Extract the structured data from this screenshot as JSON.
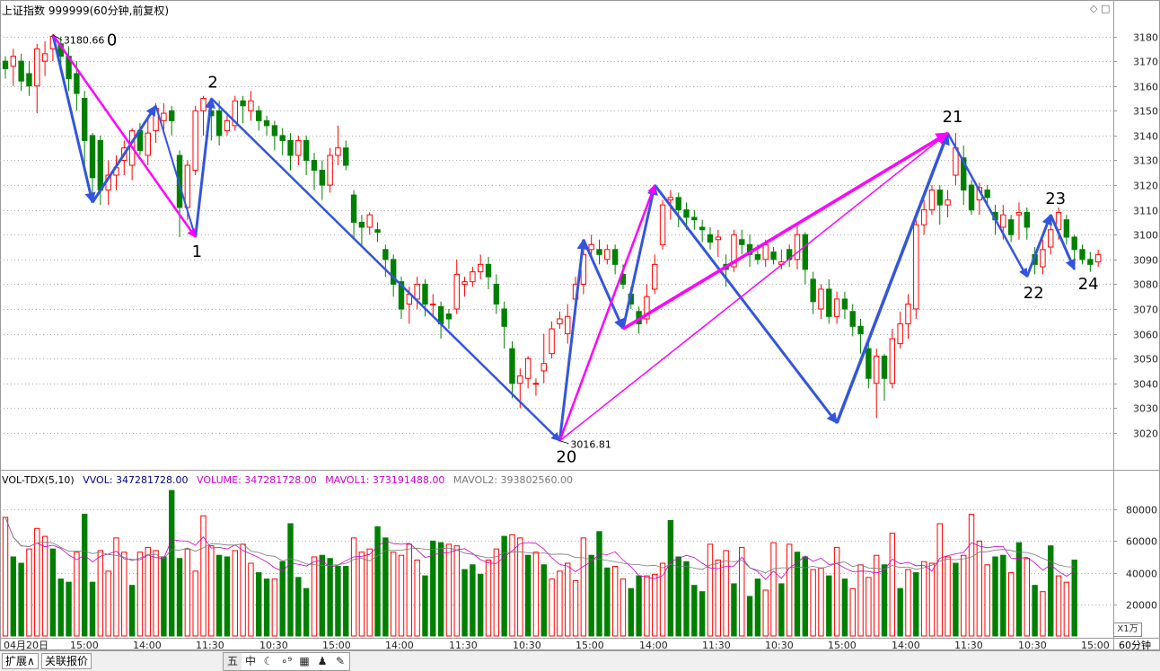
{
  "header": {
    "title": "上证指数 999999(60分钟,前复权)"
  },
  "volume_header": {
    "name": "VOL-TDX(5,10)",
    "vvol": "VVOL: 347281728.00",
    "volume": "VOLUME: 347281728.00",
    "mavol1": "MAVOL1: 373191488.00",
    "mavol2": "MAVOL2: 393802560.00"
  },
  "x_axis": {
    "labels": [
      "04月20日",
      "15:00",
      "14:00",
      "11:30",
      "10:30",
      "15:00",
      "14:00",
      "11:30",
      "10:30",
      "15:00",
      "14:00",
      "11:30",
      "10:30",
      "15:00",
      "14:00",
      "11:30",
      "10:30",
      "15:00"
    ]
  },
  "price_axis": {
    "ticks": [
      "3180",
      "3170",
      "3160",
      "3150",
      "3140",
      "3130",
      "3120",
      "3110",
      "3100",
      "3090",
      "3080",
      "3070",
      "3060",
      "3050",
      "3040",
      "3030",
      "3020"
    ]
  },
  "volume_axis": {
    "ticks": [
      "80000",
      "60000",
      "40000",
      "20000"
    ],
    "unit_label": "X1万"
  },
  "period_label": "60分钟",
  "annotations": {
    "high_price": "3180.66",
    "low_price": "3016.81",
    "wave_labels": [
      "0",
      "1",
      "2",
      "20",
      "21",
      "22",
      "23",
      "24"
    ]
  },
  "bottom_tabs": {
    "expand": "扩展∧",
    "related": "关联报价"
  },
  "toolbar": {
    "icons": [
      "五",
      "中",
      "☾",
      "∘⁹",
      "▦",
      "♟",
      "✎"
    ],
    "icon_names": [
      "five-icon",
      "zhong-icon",
      "moon-icon",
      "dots-icon",
      "keyboard-icon",
      "person-icon",
      "wrench-icon"
    ]
  },
  "top_icons": "◇ □",
  "colors": {
    "up": "#ff0000",
    "down": "#008000",
    "blue_line": "#3355dd",
    "magenta_line": "#ff00ff",
    "mavol1": "#cc00cc",
    "mavol2": "#777777",
    "grid": "#9a9a9a"
  },
  "chart_data": {
    "type": "candlestick",
    "y_range": [
      3012,
      3186
    ],
    "candles": [
      [
        3170,
        3167,
        3172,
        3163
      ],
      [
        3168,
        3172,
        3175,
        3160
      ],
      [
        3170,
        3162,
        3173,
        3158
      ],
      [
        3165,
        3160,
        3170,
        3156
      ],
      [
        3160,
        3175,
        3177,
        3149
      ],
      [
        3170,
        3173,
        3178,
        3164
      ],
      [
        3175,
        3180,
        3181,
        3170
      ],
      [
        3177,
        3172,
        3180,
        3168
      ],
      [
        3172,
        3163,
        3176,
        3158
      ],
      [
        3165,
        3157,
        3170,
        3150
      ],
      [
        3155,
        3138,
        3158,
        3128
      ],
      [
        3140,
        3123,
        3141,
        3115
      ],
      [
        3138,
        3118,
        3140,
        3112
      ],
      [
        3118,
        3124,
        3130,
        3112
      ],
      [
        3124,
        3127,
        3132,
        3118
      ],
      [
        3130,
        3135,
        3138,
        3124
      ],
      [
        3128,
        3142,
        3143,
        3122
      ],
      [
        3142,
        3134,
        3145,
        3132
      ],
      [
        3132,
        3141,
        3148,
        3128
      ],
      [
        3142,
        3151,
        3153,
        3137
      ],
      [
        3146,
        3149,
        3153,
        3142
      ],
      [
        3150,
        3146,
        3152,
        3140
      ],
      [
        3132,
        3111,
        3134,
        3099
      ],
      [
        3111,
        3128,
        3130,
        3106
      ],
      [
        3126,
        3150,
        3152,
        3124
      ],
      [
        3150,
        3155,
        3156,
        3140
      ],
      [
        3150,
        3148,
        3153,
        3138
      ],
      [
        3150,
        3140,
        3154,
        3136
      ],
      [
        3142,
        3146,
        3149,
        3140
      ],
      [
        3144,
        3154,
        3156,
        3142
      ],
      [
        3154,
        3152,
        3156,
        3145
      ],
      [
        3150,
        3154,
        3158,
        3146
      ],
      [
        3150,
        3146,
        3152,
        3142
      ],
      [
        3146,
        3144,
        3148,
        3140
      ],
      [
        3144,
        3140,
        3146,
        3134
      ],
      [
        3140,
        3138,
        3143,
        3132
      ],
      [
        3138,
        3132,
        3141,
        3126
      ],
      [
        3132,
        3138,
        3140,
        3128
      ],
      [
        3138,
        3130,
        3140,
        3124
      ],
      [
        3130,
        3126,
        3133,
        3118
      ],
      [
        3126,
        3120,
        3130,
        3114
      ],
      [
        3120,
        3132,
        3135,
        3117
      ],
      [
        3132,
        3135,
        3144,
        3128
      ],
      [
        3135,
        3128,
        3138,
        3126
      ],
      [
        3116,
        3105,
        3118,
        3098
      ],
      [
        3105,
        3103,
        3108,
        3095
      ],
      [
        3103,
        3108,
        3109,
        3100
      ],
      [
        3102,
        3101,
        3105,
        3097
      ],
      [
        3094,
        3090,
        3096,
        3083
      ],
      [
        3090,
        3080,
        3092,
        3075
      ],
      [
        3081,
        3070,
        3083,
        3066
      ],
      [
        3072,
        3076,
        3079,
        3064
      ],
      [
        3074,
        3080,
        3083,
        3070
      ],
      [
        3080,
        3072,
        3082,
        3067
      ],
      [
        3072,
        3072,
        3076,
        3067
      ],
      [
        3071,
        3064,
        3073,
        3058
      ],
      [
        3068,
        3066,
        3070,
        3062
      ],
      [
        3070,
        3084,
        3090,
        3068
      ],
      [
        3080,
        3081,
        3083,
        3075
      ],
      [
        3081,
        3085,
        3087,
        3079
      ],
      [
        3085,
        3088,
        3092,
        3082
      ],
      [
        3088,
        3083,
        3091,
        3078
      ],
      [
        3080,
        3072,
        3084,
        3068
      ],
      [
        3070,
        3063,
        3073,
        3054
      ],
      [
        3054,
        3040,
        3057,
        3034
      ],
      [
        3040,
        3043,
        3046,
        3030
      ],
      [
        3042,
        3050,
        3051,
        3038
      ],
      [
        3040,
        3040,
        3042,
        3035
      ],
      [
        3045,
        3048,
        3060,
        3040
      ],
      [
        3052,
        3062,
        3065,
        3050
      ],
      [
        3064,
        3066,
        3069,
        3062
      ],
      [
        3060,
        3067,
        3072,
        3056
      ],
      [
        3074,
        3080,
        3083,
        3068
      ],
      [
        3080,
        3092,
        3095,
        3076
      ],
      [
        3094,
        3096,
        3100,
        3090
      ],
      [
        3094,
        3092,
        3098,
        3088
      ],
      [
        3090,
        3094,
        3096,
        3088
      ],
      [
        3094,
        3088,
        3096,
        3084
      ],
      [
        3084,
        3080,
        3088,
        3078
      ],
      [
        3076,
        3072,
        3079,
        3070
      ],
      [
        3069,
        3064,
        3071,
        3060
      ],
      [
        3066,
        3075,
        3080,
        3064
      ],
      [
        3078,
        3088,
        3092,
        3076
      ],
      [
        3096,
        3112,
        3114,
        3094
      ],
      [
        3114,
        3115,
        3118,
        3106
      ],
      [
        3115,
        3110,
        3117,
        3103
      ],
      [
        3110,
        3107,
        3113,
        3102
      ],
      [
        3107,
        3106,
        3110,
        3102
      ],
      [
        3103,
        3102,
        3106,
        3097
      ],
      [
        3100,
        3097,
        3103,
        3094
      ],
      [
        3098,
        3099,
        3102,
        3091
      ],
      [
        3088,
        3086,
        3092,
        3079
      ],
      [
        3087,
        3100,
        3102,
        3085
      ],
      [
        3098,
        3096,
        3102,
        3092
      ],
      [
        3096,
        3092,
        3100,
        3087
      ],
      [
        3092,
        3090,
        3096,
        3088
      ],
      [
        3090,
        3096,
        3098,
        3087
      ],
      [
        3093,
        3090,
        3095,
        3088
      ],
      [
        3088,
        3089,
        3094,
        3086
      ],
      [
        3094,
        3090,
        3096,
        3087
      ],
      [
        3090,
        3100,
        3104,
        3086
      ],
      [
        3100,
        3086,
        3101,
        3080
      ],
      [
        3082,
        3073,
        3085,
        3068
      ],
      [
        3070,
        3078,
        3080,
        3066
      ],
      [
        3078,
        3067,
        3082,
        3064
      ],
      [
        3067,
        3074,
        3077,
        3064
      ],
      [
        3074,
        3070,
        3077,
        3066
      ],
      [
        3069,
        3063,
        3072,
        3059
      ],
      [
        3063,
        3060,
        3066,
        3052
      ],
      [
        3054,
        3042,
        3057,
        3038
      ],
      [
        3040,
        3051,
        3054,
        3026
      ],
      [
        3051,
        3042,
        3052,
        3033
      ],
      [
        3040,
        3058,
        3062,
        3038
      ],
      [
        3056,
        3064,
        3069,
        3054
      ],
      [
        3064,
        3072,
        3076,
        3058
      ],
      [
        3070,
        3104,
        3106,
        3066
      ],
      [
        3104,
        3110,
        3114,
        3100
      ],
      [
        3110,
        3118,
        3120,
        3108
      ],
      [
        3118,
        3112,
        3120,
        3104
      ],
      [
        3112,
        3114,
        3118,
        3107
      ],
      [
        3124,
        3135,
        3141,
        3120
      ],
      [
        3131,
        3118,
        3136,
        3112
      ],
      [
        3120,
        3110,
        3122,
        3108
      ],
      [
        3114,
        3119,
        3121,
        3108
      ],
      [
        3118,
        3115,
        3120,
        3112
      ],
      [
        3109,
        3106,
        3112,
        3100
      ],
      [
        3103,
        3108,
        3112,
        3098
      ],
      [
        3106,
        3100,
        3108,
        3097
      ],
      [
        3108,
        3109,
        3113,
        3098
      ],
      [
        3109,
        3103,
        3111,
        3098
      ],
      [
        3092,
        3088,
        3095,
        3084
      ],
      [
        3087,
        3094,
        3098,
        3084
      ],
      [
        3095,
        3102,
        3105,
        3092
      ],
      [
        3102,
        3109,
        3111,
        3098
      ],
      [
        3106,
        3099,
        3108,
        3096
      ],
      [
        3099,
        3094,
        3100,
        3090
      ],
      [
        3094,
        3090,
        3096,
        3088
      ],
      [
        3090,
        3088,
        3093,
        3085
      ],
      [
        3089,
        3092,
        3094,
        3087
      ]
    ],
    "volumes": [
      [
        75,
        0
      ],
      [
        50,
        1
      ],
      [
        46,
        1
      ],
      [
        55,
        0
      ],
      [
        68,
        0
      ],
      [
        63,
        0
      ],
      [
        55,
        1
      ],
      [
        36,
        1
      ],
      [
        34,
        1
      ],
      [
        53,
        0
      ],
      [
        77,
        1
      ],
      [
        34,
        1
      ],
      [
        54,
        0
      ],
      [
        41,
        0
      ],
      [
        62,
        0
      ],
      [
        53,
        0
      ],
      [
        32,
        1
      ],
      [
        53,
        0
      ],
      [
        56,
        0
      ],
      [
        54,
        0
      ],
      [
        50,
        1
      ],
      [
        92,
        1
      ],
      [
        49,
        1
      ],
      [
        55,
        0
      ],
      [
        41,
        0
      ],
      [
        76,
        0
      ],
      [
        57,
        0
      ],
      [
        51,
        1
      ],
      [
        50,
        1
      ],
      [
        54,
        0
      ],
      [
        58,
        0
      ],
      [
        46,
        0
      ],
      [
        40,
        1
      ],
      [
        36,
        1
      ],
      [
        36,
        0
      ],
      [
        47,
        1
      ],
      [
        71,
        1
      ],
      [
        37,
        1
      ],
      [
        30,
        1
      ],
      [
        50,
        0
      ],
      [
        51,
        1
      ],
      [
        49,
        1
      ],
      [
        44,
        1
      ],
      [
        44,
        1
      ],
      [
        62,
        0
      ],
      [
        53,
        0
      ],
      [
        55,
        0
      ],
      [
        69,
        1
      ],
      [
        62,
        1
      ],
      [
        53,
        0
      ],
      [
        51,
        0
      ],
      [
        58,
        0
      ],
      [
        48,
        0
      ],
      [
        38,
        1
      ],
      [
        60,
        1
      ],
      [
        59,
        1
      ],
      [
        58,
        0
      ],
      [
        57,
        0
      ],
      [
        42,
        1
      ],
      [
        45,
        1
      ],
      [
        39,
        1
      ],
      [
        48,
        0
      ],
      [
        55,
        0
      ],
      [
        63,
        1
      ],
      [
        64,
        0
      ],
      [
        62,
        0
      ],
      [
        51,
        1
      ],
      [
        53,
        0
      ],
      [
        45,
        1
      ],
      [
        36,
        0
      ],
      [
        41,
        0
      ],
      [
        46,
        0
      ],
      [
        35,
        0
      ],
      [
        62,
        0
      ],
      [
        51,
        1
      ],
      [
        66,
        1
      ],
      [
        43,
        1
      ],
      [
        44,
        0
      ],
      [
        36,
        0
      ],
      [
        30,
        1
      ],
      [
        38,
        1
      ],
      [
        38,
        0
      ],
      [
        39,
        0
      ],
      [
        46,
        0
      ],
      [
        73,
        1
      ],
      [
        50,
        1
      ],
      [
        47,
        1
      ],
      [
        32,
        1
      ],
      [
        28,
        1
      ],
      [
        58,
        0
      ],
      [
        48,
        0
      ],
      [
        54,
        0
      ],
      [
        33,
        1
      ],
      [
        56,
        0
      ],
      [
        25,
        1
      ],
      [
        36,
        1
      ],
      [
        29,
        0
      ],
      [
        59,
        0
      ],
      [
        33,
        1
      ],
      [
        58,
        0
      ],
      [
        53,
        1
      ],
      [
        50,
        1
      ],
      [
        42,
        0
      ],
      [
        43,
        0
      ],
      [
        38,
        1
      ],
      [
        56,
        0
      ],
      [
        36,
        1
      ],
      [
        30,
        0
      ],
      [
        45,
        0
      ],
      [
        37,
        0
      ],
      [
        51,
        0
      ],
      [
        45,
        1
      ],
      [
        65,
        0
      ],
      [
        30,
        1
      ],
      [
        42,
        0
      ],
      [
        40,
        1
      ],
      [
        47,
        0
      ],
      [
        46,
        0
      ],
      [
        71,
        0
      ],
      [
        50,
        0
      ],
      [
        46,
        1
      ],
      [
        51,
        0
      ],
      [
        77,
        0
      ],
      [
        60,
        0
      ],
      [
        45,
        0
      ],
      [
        50,
        1
      ],
      [
        51,
        1
      ],
      [
        40,
        0
      ],
      [
        59,
        1
      ],
      [
        49,
        0
      ],
      [
        32,
        1
      ],
      [
        28,
        0
      ],
      [
        57,
        1
      ],
      [
        38,
        0
      ],
      [
        34,
        0
      ],
      [
        48,
        1
      ]
    ],
    "annotation_points": [
      {
        "label": "0",
        "index": 6,
        "price": 3180.66
      },
      {
        "label": "1",
        "index": 24,
        "price": 3099
      },
      {
        "label": "2",
        "index": 26,
        "price": 3155
      },
      {
        "label": "20",
        "index": 70,
        "price": 3016.81
      },
      {
        "label": "21",
        "index": 119,
        "price": 3141
      },
      {
        "label": "22",
        "index": 129,
        "price": 3083
      },
      {
        "label": "23",
        "index": 132,
        "price": 3108
      },
      {
        "label": "24",
        "index": 135,
        "price": 3086
      }
    ]
  }
}
